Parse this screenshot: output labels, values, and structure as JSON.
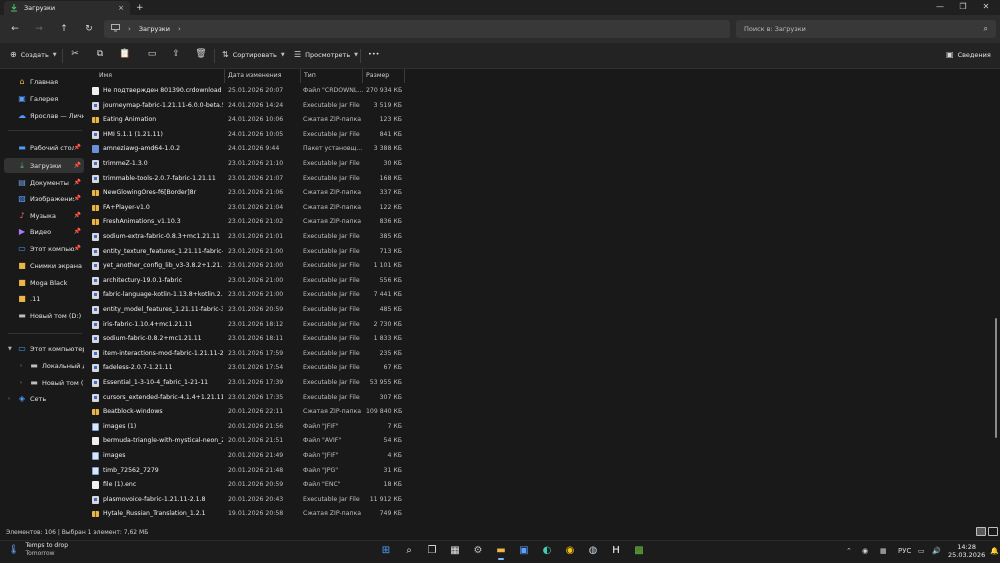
{
  "window": {
    "tab_title": "Загрузки",
    "new_tab": "+",
    "tab_close": "×",
    "controls": {
      "minimize": "—",
      "maximize": "❐",
      "close": "✕"
    }
  },
  "nav": {
    "back": "←",
    "forward": "→",
    "up": "↑",
    "refresh": "↻",
    "address_icon": "monitor-icon",
    "address_path": "Загрузки",
    "search_placeholder": "Поиск в: Загрузки"
  },
  "commands": {
    "create": "Создать",
    "sort": "Сортировать",
    "view": "Просмотреть",
    "more": "•••",
    "details": "Сведения"
  },
  "sidebar": {
    "items": [
      {
        "label": "Главная",
        "icon": "home-icon",
        "pin": false
      },
      {
        "label": "Галерея",
        "icon": "gallery-icon",
        "pin": false
      },
      {
        "label": "Ярослав — Личное",
        "icon": "cloud-icon",
        "pin": false
      },
      {
        "label": "Рабочий стол",
        "icon": "desktop-icon",
        "pin": true
      },
      {
        "label": "Загрузки",
        "icon": "downloads-icon",
        "pin": true,
        "selected": true
      },
      {
        "label": "Документы",
        "icon": "documents-icon",
        "pin": true
      },
      {
        "label": "Изображения",
        "icon": "pictures-icon",
        "pin": true
      },
      {
        "label": "Музыка",
        "icon": "music-icon",
        "pin": true
      },
      {
        "label": "Видео",
        "icon": "video-icon",
        "pin": true
      },
      {
        "label": "Этот компьютер",
        "icon": "computer-icon",
        "pin": true
      },
      {
        "label": "Снимки экрана",
        "icon": "folder-icon",
        "pin": false
      },
      {
        "label": "Moga Black",
        "icon": "folder-icon",
        "pin": false
      },
      {
        "label": ".11",
        "icon": "folder-icon",
        "pin": false
      },
      {
        "label": "Новый том (D:)",
        "icon": "drive-icon",
        "pin": false
      }
    ],
    "tree": [
      {
        "label": "Этот компьютер",
        "icon": "computer-icon",
        "expanded": true
      },
      {
        "label": "Локальный диск",
        "icon": "drive-icon"
      },
      {
        "label": "Новый том (D:)",
        "icon": "drive-icon"
      },
      {
        "label": "Сеть",
        "icon": "network-icon"
      }
    ]
  },
  "columns": {
    "name": "Имя",
    "date": "Дата изменения",
    "type": "Тип",
    "size": "Размер"
  },
  "files": [
    {
      "name": "Не подтвержден 801390.crdownload",
      "date": "25.01.2026 20:07",
      "type": "Файл \"CRDOWNL...",
      "size": "270 934 КБ",
      "kind": "file"
    },
    {
      "name": "journeymap-fabric-1.21.11-6.0.0-beta.55",
      "date": "24.01.2026 14:24",
      "type": "Executable Jar File",
      "size": "3 519 КБ",
      "kind": "jar"
    },
    {
      "name": "Eating Animation",
      "date": "24.01.2026 10:06",
      "type": "Сжатая ZIP-папка",
      "size": "123 КБ",
      "kind": "zip"
    },
    {
      "name": "HMI 5.1.1 (1.21.11)",
      "date": "24.01.2026 10:05",
      "type": "Executable Jar File",
      "size": "841 КБ",
      "kind": "jar"
    },
    {
      "name": "amneziawg-amd64-1.0.2",
      "date": "24.01.2026 9:44",
      "type": "Пакет установщ...",
      "size": "3 388 КБ",
      "kind": "pkg"
    },
    {
      "name": "trimmeZ-1.3.0",
      "date": "23.01.2026 21:10",
      "type": "Executable Jar File",
      "size": "30 КБ",
      "kind": "jar"
    },
    {
      "name": "trimmable-tools-2.0.7-fabric-1.21.11",
      "date": "23.01.2026 21:07",
      "type": "Executable Jar File",
      "size": "168 КБ",
      "kind": "jar"
    },
    {
      "name": "NewGlowingOres-f6[Border]8r",
      "date": "23.01.2026 21:06",
      "type": "Сжатая ZIP-папка",
      "size": "337 КБ",
      "kind": "zip"
    },
    {
      "name": "FA+Player-v1.0",
      "date": "23.01.2026 21:04",
      "type": "Сжатая ZIP-папка",
      "size": "122 КБ",
      "kind": "zip"
    },
    {
      "name": "FreshAnimations_v1.10.3",
      "date": "23.01.2026 21:02",
      "type": "Сжатая ZIP-папка",
      "size": "836 КБ",
      "kind": "zip"
    },
    {
      "name": "sodium-extra-fabric-0.8.3+mc1.21.11",
      "date": "23.01.2026 21:01",
      "type": "Executable Jar File",
      "size": "385 КБ",
      "kind": "jar"
    },
    {
      "name": "entity_texture_features_1.21.11-fabric-7.0.8",
      "date": "23.01.2026 21:00",
      "type": "Executable Jar File",
      "size": "713 КБ",
      "kind": "jar"
    },
    {
      "name": "yet_another_config_lib_v3-3.8.2+1.21.11-...",
      "date": "23.01.2026 21:00",
      "type": "Executable Jar File",
      "size": "1 101 КБ",
      "kind": "jar"
    },
    {
      "name": "architectury-19.0.1-fabric",
      "date": "23.01.2026 21:00",
      "type": "Executable Jar File",
      "size": "556 КБ",
      "kind": "jar"
    },
    {
      "name": "fabric-language-kotlin-1.13.8+kotlin.2.3.0",
      "date": "23.01.2026 21:00",
      "type": "Executable Jar File",
      "size": "7 441 КБ",
      "kind": "jar"
    },
    {
      "name": "entity_model_features_1.21.11-fabric-3.0...",
      "date": "23.01.2026 20:59",
      "type": "Executable Jar File",
      "size": "485 КБ",
      "kind": "jar"
    },
    {
      "name": "iris-fabric-1.10.4+mc1.21.11",
      "date": "23.01.2026 18:12",
      "type": "Executable Jar File",
      "size": "2 730 КБ",
      "kind": "jar"
    },
    {
      "name": "sodium-fabric-0.8.2+mc1.21.11",
      "date": "23.01.2026 18:11",
      "type": "Executable Jar File",
      "size": "1 833 КБ",
      "kind": "jar"
    },
    {
      "name": "item-interactions-mod-fabric-1.21.11-2.2.6",
      "date": "23.01.2026 17:59",
      "type": "Executable Jar File",
      "size": "235 КБ",
      "kind": "jar"
    },
    {
      "name": "fadeless-2.0.7-1.21.11",
      "date": "23.01.2026 17:54",
      "type": "Executable Jar File",
      "size": "67 КБ",
      "kind": "jar"
    },
    {
      "name": "Essential_1-3-10-4_fabric_1-21-11",
      "date": "23.01.2026 17:39",
      "type": "Executable Jar File",
      "size": "53 955 КБ",
      "kind": "jar"
    },
    {
      "name": "cursors_extended-fabric-4.1.4+1.21.11-p...",
      "date": "23.01.2026 17:35",
      "type": "Executable Jar File",
      "size": "307 КБ",
      "kind": "jar"
    },
    {
      "name": "Beatblock-windows",
      "date": "20.01.2026 22:11",
      "type": "Сжатая ZIP-папка",
      "size": "109 840 КБ",
      "kind": "zip"
    },
    {
      "name": "images (1)",
      "date": "20.01.2026 21:56",
      "type": "Файл \"JFIF\"",
      "size": "7 КБ",
      "kind": "img"
    },
    {
      "name": "bermuda-triangle-with-mystical-neon_2...",
      "date": "20.01.2026 21:51",
      "type": "Файл \"AVIF\"",
      "size": "54 КБ",
      "kind": "file"
    },
    {
      "name": "images",
      "date": "20.01.2026 21:49",
      "type": "Файл \"JFIF\"",
      "size": "4 КБ",
      "kind": "img"
    },
    {
      "name": "timb_72562_7279",
      "date": "20.01.2026 21:48",
      "type": "Файл \"JPG\"",
      "size": "31 КБ",
      "kind": "img"
    },
    {
      "name": "file (1).enc",
      "date": "20.01.2026 20:59",
      "type": "Файл \"ENC\"",
      "size": "18 КБ",
      "kind": "file"
    },
    {
      "name": "plasmovoice-fabric-1.21.11-2.1.8",
      "date": "20.01.2026 20:43",
      "type": "Executable Jar File",
      "size": "11 912 КБ",
      "kind": "jar"
    },
    {
      "name": "Hytale_Russian_Translation_1.2.1",
      "date": "19.01.2026 20:58",
      "type": "Сжатая ZIP-папка",
      "size": "749 КБ",
      "kind": "zip"
    }
  ],
  "status": {
    "text": "Элементов: 106  |  Выбран 1 элемент: 7,62 МБ"
  },
  "taskbar": {
    "weather_line1": "Temps to drop",
    "weather_line2": "Tomorrow",
    "language": "РУС",
    "time": "14:28",
    "date": "25.03.2026",
    "apps": [
      "windows-start-icon",
      "search-icon",
      "task-view-icon",
      "widgets-icon",
      "settings-icon",
      "file-explorer-icon",
      "store-icon",
      "edge-icon",
      "chrome-icon",
      "steam-icon",
      "app-h-icon",
      "minecraft-icon"
    ]
  },
  "colors": {
    "accent": "#7fb4ff",
    "folder": "#e8b64a",
    "background": "#191919"
  }
}
